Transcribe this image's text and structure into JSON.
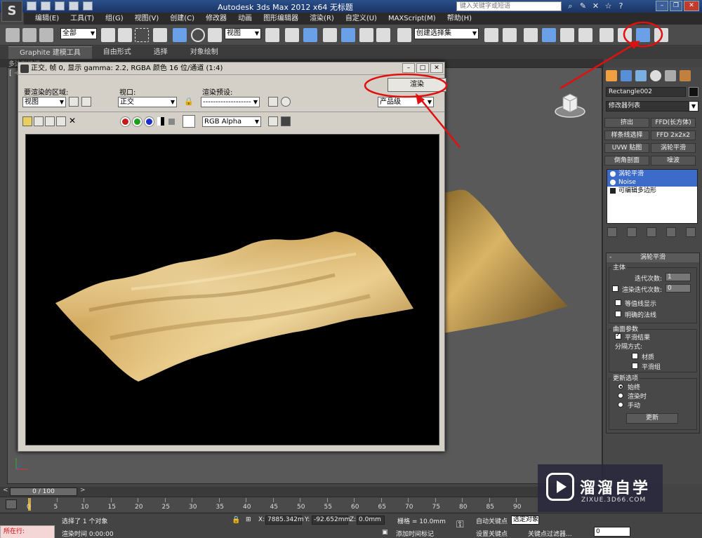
{
  "app": {
    "logo_text": "S",
    "title": "Autodesk 3ds Max  2012 x64      无标题",
    "search_placeholder": "键入关键字或短语"
  },
  "menu": [
    "编辑(E)",
    "工具(T)",
    "组(G)",
    "视图(V)",
    "创建(C)",
    "修改器",
    "动画",
    "图形编辑器",
    "渲染(R)",
    "自定义(U)",
    "MAXScript(M)",
    "帮助(H)"
  ],
  "toolbar": {
    "selection_filter": "全部",
    "ref_coord": "视图",
    "named_selection": "创建选择集"
  },
  "ribbon": {
    "tabs": [
      "Graphite 建模工具",
      "自由形式",
      "选择",
      "对象绘制"
    ],
    "sub_label": "多边形建模"
  },
  "viewport": {
    "label": "[ + ]"
  },
  "render_window": {
    "title": "正交, 帧 0, 显示 gamma: 2.2, RGBA 颜色 16 位/通道 (1:4)",
    "area_label": "要渲染的区域:",
    "area_value": "视图",
    "viewport_label": "视口:",
    "viewport_value": "正交",
    "preset_label": "渲染预设:",
    "preset_value": "-------------------",
    "render_button": "渲染",
    "quality_value": "产品级",
    "channel_value": "RGB Alpha"
  },
  "command_panel": {
    "object_name": "Rectangle002",
    "modifier_list": "修改器列表",
    "modifier_buttons": [
      "挤出",
      "FFD(长方体)",
      "样条线选择",
      "FFD 2x2x2",
      "UVW 贴图",
      "涡轮平滑",
      "倒角剖面",
      "噪波"
    ],
    "stack": [
      "涡轮平滑",
      "Noise",
      "可编辑多边形"
    ],
    "rollout_title": "涡轮平滑",
    "main_group": "主体",
    "iterations_label": "迭代次数:",
    "iterations_value": "1",
    "render_iters_label": "渲染迭代次数:",
    "render_iters_value": "0",
    "isoline_label": "等值线显示",
    "explicit_normals_label": "明确的法线",
    "surface_group": "曲面参数",
    "smooth_result_label": "平滑结果",
    "separate_by_label": "分隔方式:",
    "materials_label": "材质",
    "smoothing_groups_label": "平滑组",
    "update_group": "更新选项",
    "always_label": "始终",
    "when_rendering_label": "渲染时",
    "manually_label": "手动",
    "update_button": "更新"
  },
  "timeline": {
    "frame_counter": "0 / 100",
    "ticks": [
      "0",
      "5",
      "10",
      "15",
      "20",
      "25",
      "30",
      "35",
      "40",
      "45",
      "50",
      "55",
      "60",
      "65",
      "70",
      "75",
      "80",
      "85",
      "90"
    ]
  },
  "status": {
    "running_label": "所在行:",
    "selected_text": "选择了 1 个对象",
    "render_time": "渲染时间  0:00:00",
    "x_label": "X:",
    "x_value": "7885.342m",
    "y_label": "Y:",
    "y_value": "-92.652mm",
    "z_label": "Z:",
    "z_value": "0.0mm",
    "grid_text": "栅格 = 10.0mm",
    "add_time_tag": "添加时间标记",
    "auto_key": "自动关键点",
    "selected_obj": "选定对象",
    "set_key": "设置关键点",
    "key_filters": "关键点过滤器...",
    "frame_value": "0"
  },
  "watermark": {
    "title": "溜溜自学",
    "subtitle": "ZIXUE.3D66.COM"
  }
}
